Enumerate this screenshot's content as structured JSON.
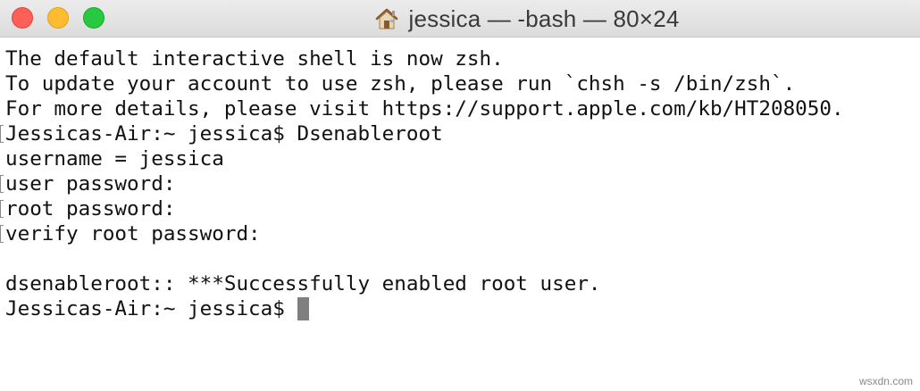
{
  "window": {
    "title": "jessica — -bash — 80×24",
    "title_icon": "home-icon",
    "colors": {
      "close": "#fe5f57",
      "minimize": "#febc2e",
      "zoom": "#28c840",
      "background": "#ffffff",
      "text": "#111111",
      "cursor": "#7f7f7f"
    }
  },
  "terminal": {
    "lines": [
      {
        "text": "The default interactive shell is now zsh.",
        "mark": false
      },
      {
        "text": "To update your account to use zsh, please run `chsh -s /bin/zsh`.",
        "mark": false
      },
      {
        "text": "For more details, please visit https://support.apple.com/kb/HT208050.",
        "mark": false
      },
      {
        "text": "Jessicas-Air:~ jessica$ Dsenableroot",
        "mark": true
      },
      {
        "text": "username = jessica",
        "mark": false
      },
      {
        "text": "user password:",
        "mark": true
      },
      {
        "text": "root password:",
        "mark": true
      },
      {
        "text": "verify root password:",
        "mark": true
      },
      {
        "text": "",
        "mark": false
      },
      {
        "text": "dsenableroot:: ***Successfully enabled root user.",
        "mark": false
      }
    ],
    "prompt": "Jessicas-Air:~ jessica$ "
  },
  "watermark": "wsxdn.com"
}
